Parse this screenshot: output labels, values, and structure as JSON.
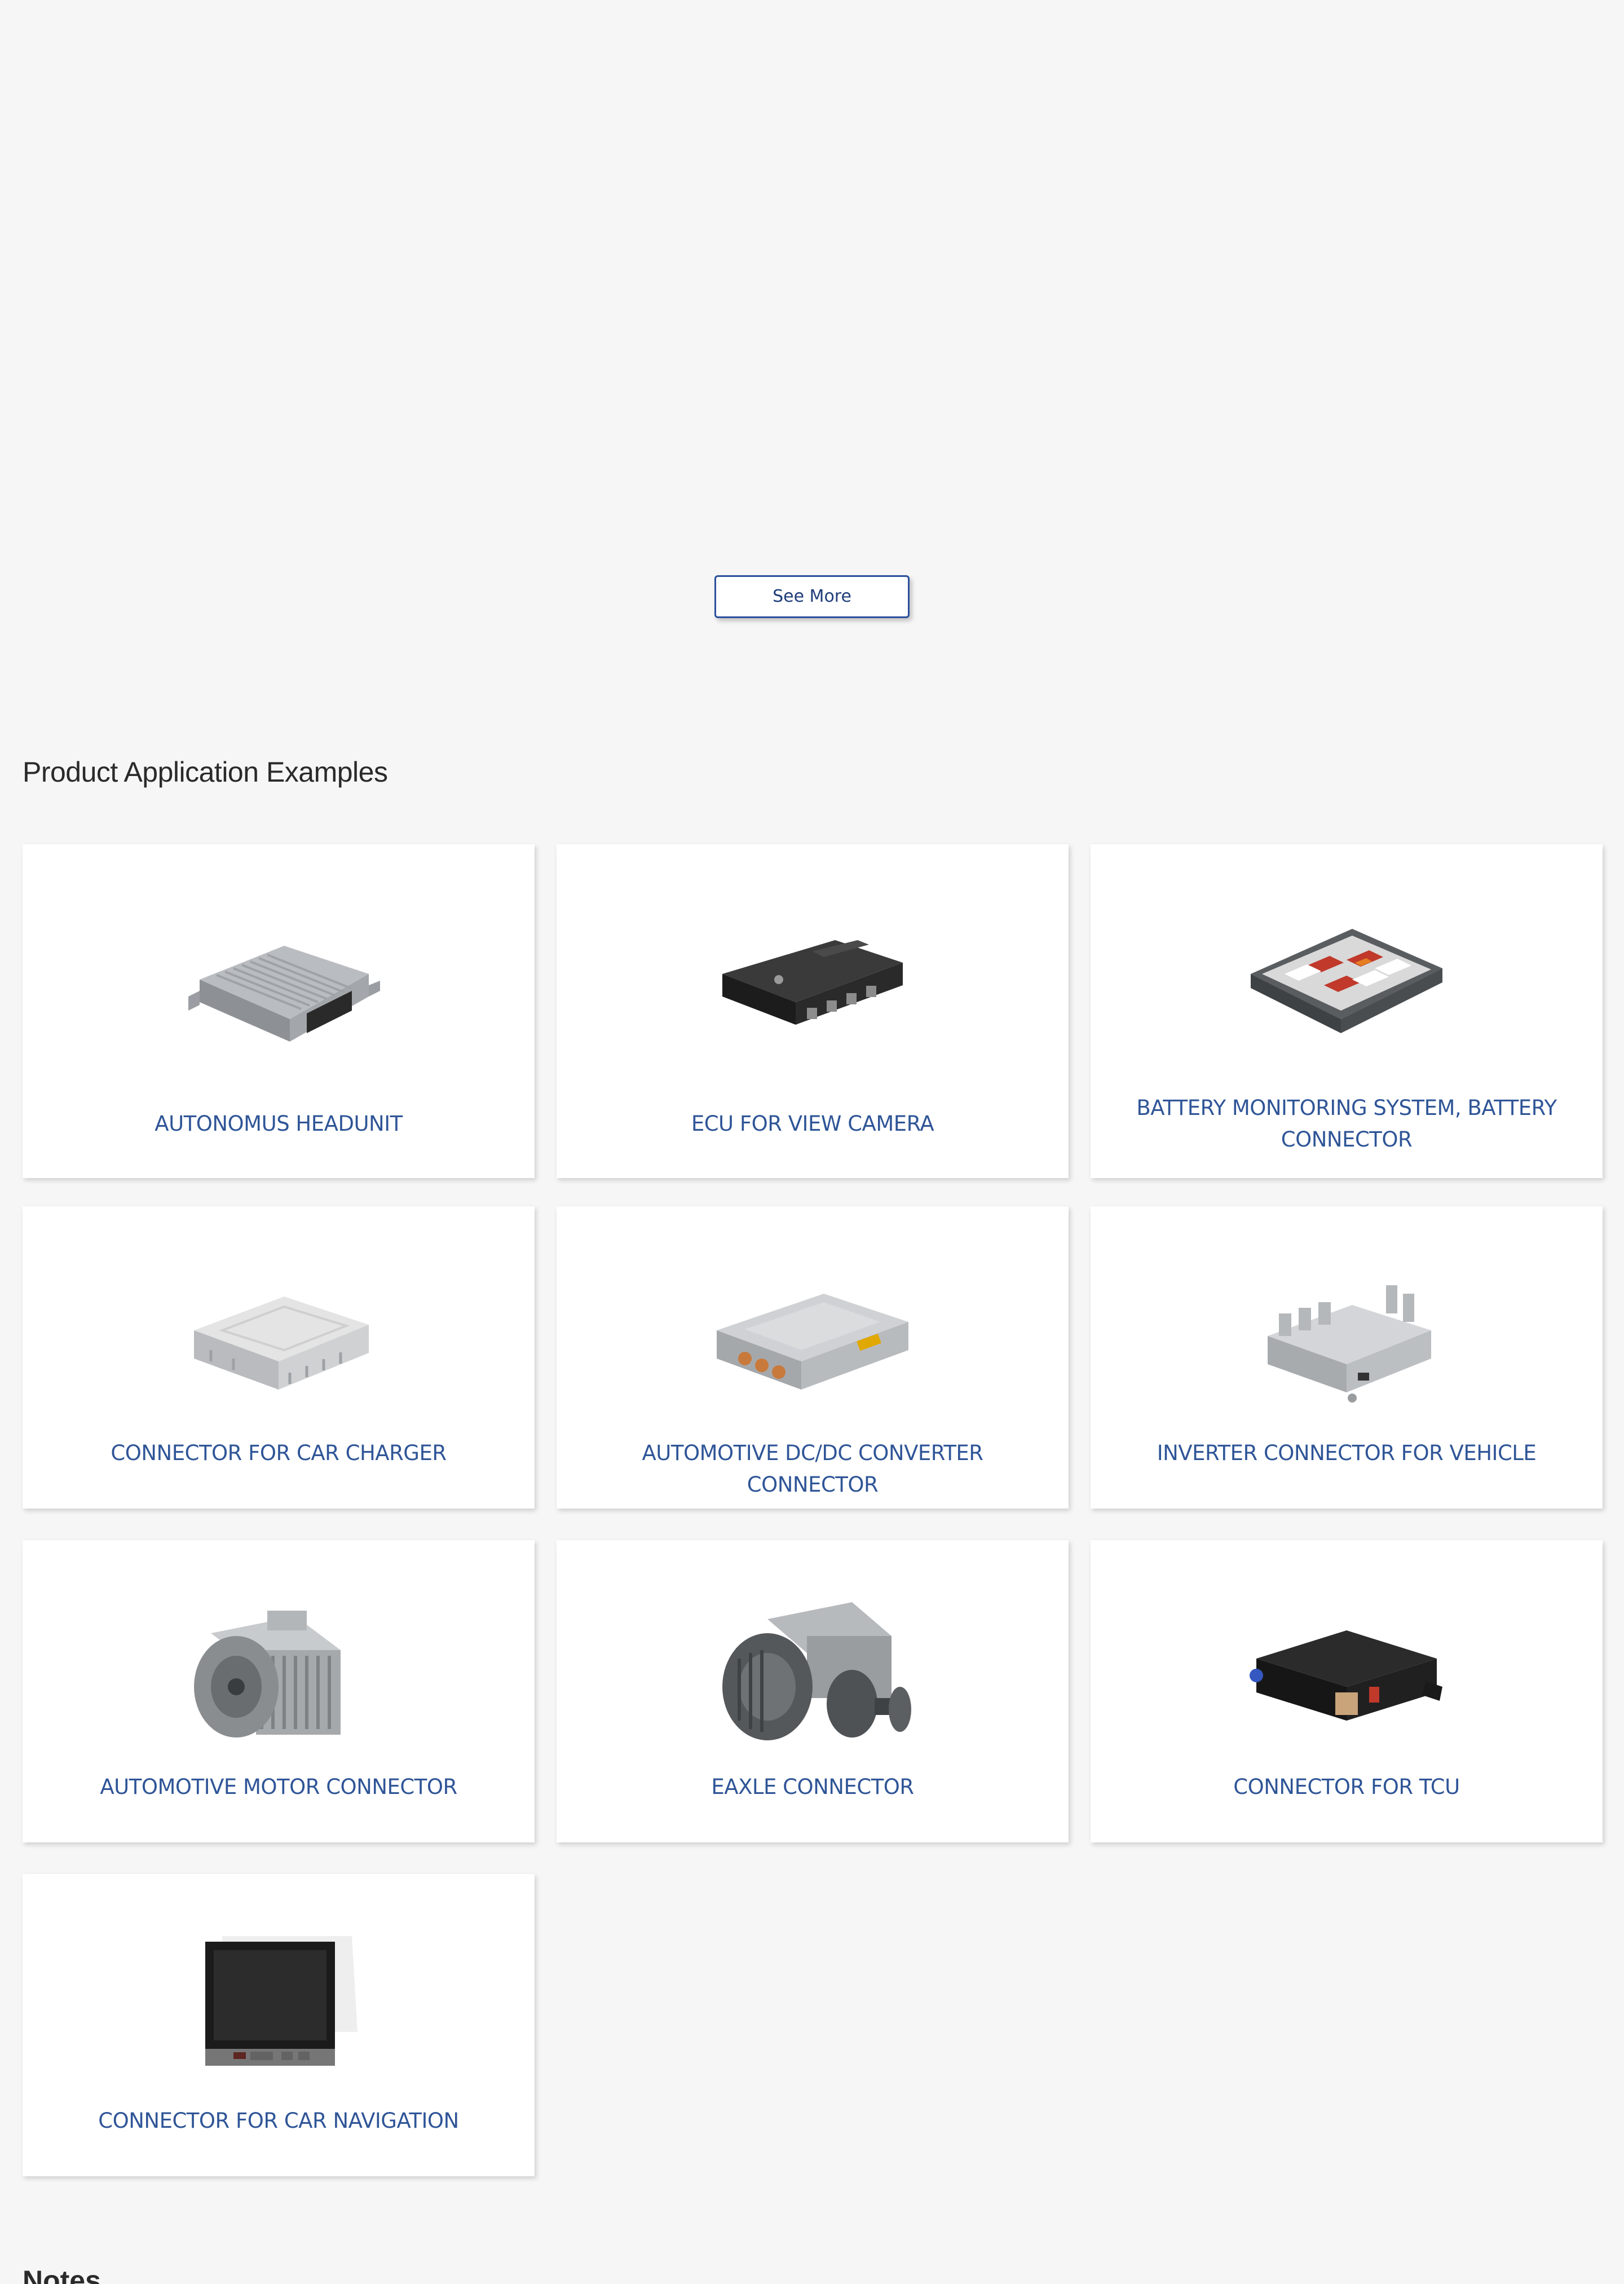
{
  "see_more": {
    "label": "See More"
  },
  "section": {
    "title": "Product Application Examples"
  },
  "products": [
    {
      "label": "AUTONOMUS HEADUNIT",
      "icon": "headunit-module-icon"
    },
    {
      "label": "ECU FOR VIEW CAMERA",
      "icon": "ecu-module-icon"
    },
    {
      "label": "BATTERY MONITORING SYSTEM, BATTERY CONNECTOR",
      "icon": "battery-pack-icon"
    },
    {
      "label": "CONNECTOR FOR CAR CHARGER",
      "icon": "charger-module-icon"
    },
    {
      "label": "AUTOMOTIVE DC/DC CONVERTER CONNECTOR",
      "icon": "dcdc-converter-icon"
    },
    {
      "label": "INVERTER CONNECTOR FOR VEHICLE",
      "icon": "inverter-module-icon"
    },
    {
      "label": "AUTOMOTIVE MOTOR CONNECTOR",
      "icon": "motor-icon"
    },
    {
      "label": "EAXLE CONNECTOR",
      "icon": "eaxle-icon"
    },
    {
      "label": "CONNECTOR FOR TCU",
      "icon": "tcu-module-icon"
    },
    {
      "label": "CONNECTOR FOR CAR NAVIGATION",
      "icon": "navigation-display-icon"
    }
  ],
  "notes": {
    "title": "Notes"
  },
  "colors": {
    "background": "#f6f6f6",
    "card": "#ffffff",
    "link": "#2f5597",
    "button_border": "#2a4f9c"
  }
}
